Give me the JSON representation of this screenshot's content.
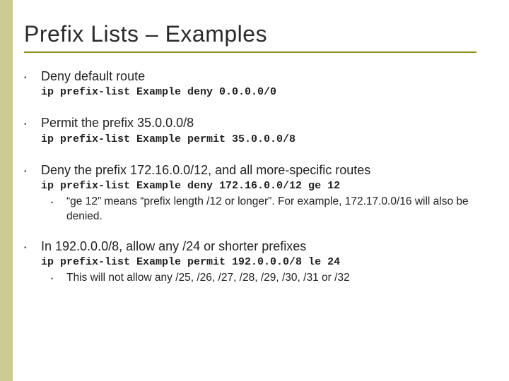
{
  "title": "Prefix Lists – Examples",
  "items": [
    {
      "heading": "Deny default route",
      "cmd": "ip prefix-list Example deny 0.0.0.0/0",
      "subs": []
    },
    {
      "heading": "Permit the prefix 35.0.0.0/8",
      "cmd": "ip prefix-list Example permit 35.0.0.0/8",
      "subs": []
    },
    {
      "heading": "Deny the prefix 172.16.0.0/12, and all more-specific routes",
      "cmd": "ip prefix-list Example deny 172.16.0.0/12 ge 12",
      "subs": [
        "“ge 12” means “prefix length /12 or longer”. For example, 172.17.0.0/16 will also be denied."
      ]
    },
    {
      "heading": "In 192.0.0.0/8, allow any /24 or shorter prefixes",
      "cmd": "ip prefix-list Example permit 192.0.0.0/8 le 24",
      "subs": [
        "This will not allow any /25, /26, /27, /28, /29, /30, /31 or /32"
      ]
    }
  ]
}
